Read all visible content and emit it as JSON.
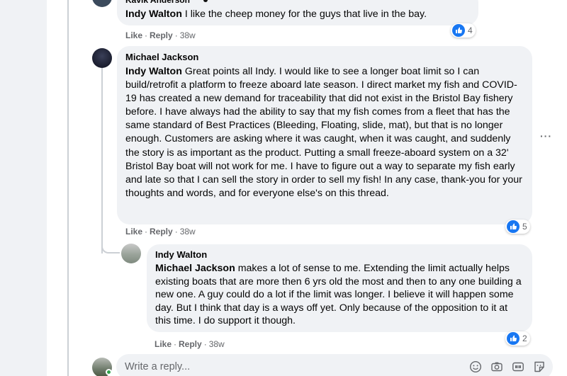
{
  "comments": [
    {
      "author": "Kavik Anderson",
      "tag": "Indy Walton",
      "text": " I like the cheep money for the guys that live in the bay.",
      "like": "Like",
      "reply": "Reply",
      "time": "38w",
      "reactions": "4"
    },
    {
      "author": "Michael Jackson",
      "tag": "Indy Walton",
      "text": " Great points all Indy. I would like to see a longer boat limit so I can build/retrofit a platform to freeze aboard late season. I direct market my fish and COVID-19 has created a new demand for traceability that did not exist in the Bristol Bay fishery before. I have always had the ability to say that my fish comes from a fleet that has the same standard of Best Practices (Bleeding, Floating, slide, mat), but that is no longer enough. Customers are asking where it was caught, when it was caught, and suddenly the story is as important as the product. Putting a small freeze-aboard system on a 32' Bristol Bay boat will not work for me. I have to figure out a way to separate my fish early and late so that I can sell the story in order to sell my fish! In any case, thank-you for your thoughts and words, and for everyone else's on this thread.",
      "like": "Like",
      "reply": "Reply",
      "time": "38w",
      "reactions": "5"
    },
    {
      "author": "Indy Walton",
      "tag": "Michael Jackson",
      "text": " makes a lot of sense to me. Extending the limit actually helps existing boats that are more then 6 yrs old the most and then to any one building a new one. A guy could do a lot if the limit was longer. I believe it will happen some day. But I think that day is a ways off yet. Only because of the opposition to it at this time. I do support it though.",
      "like": "Like",
      "reply": "Reply",
      "time": "38w",
      "reactions": "2"
    }
  ],
  "reply_box": {
    "placeholder": "Write a reply...",
    "icons": [
      "emoji-icon",
      "camera-icon",
      "gif-icon",
      "sticker-icon"
    ]
  },
  "colors": {
    "like_blue": "#1877f2",
    "bubble": "#f0f2f5",
    "meta": "#65676b"
  }
}
